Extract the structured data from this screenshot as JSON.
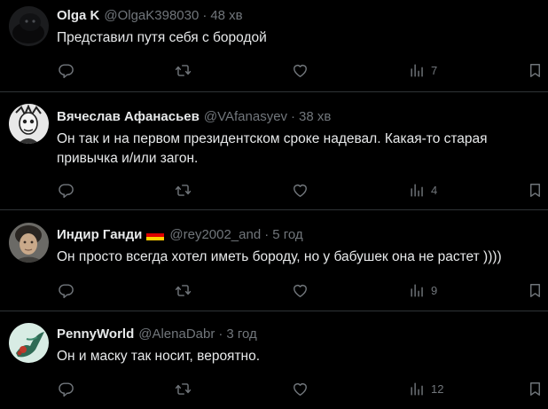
{
  "tweets": [
    {
      "name": "Olga K",
      "handle": "@OlgaK398030",
      "separator": "·",
      "time": "48 хв",
      "text": "Представил путя себя с бородой",
      "views": "7",
      "flag": false
    },
    {
      "name": "Вячеслав Афанасьев",
      "handle": "@VAfanasyev",
      "separator": "·",
      "time": "38 хв",
      "text": "Он так и на первом президентском сроке надевал. Какая-то старая привычка и/или загон.",
      "views": "4",
      "flag": false
    },
    {
      "name": "Индир Ганди",
      "handle": "@rey2002_and",
      "separator": "·",
      "time": "5 год",
      "text": "Он просто всегда хотел иметь бороду, но у бабушек она не растет ))))",
      "views": "9",
      "flag": true
    },
    {
      "name": "PennyWorld",
      "handle": "@AlenaDabr",
      "separator": "·",
      "time": "3 год",
      "text": "Он и маску так носит, вероятно.",
      "views": "12",
      "flag": false
    }
  ],
  "colors": {
    "background": "#000000",
    "text": "#e7e9ea",
    "muted": "#71767b",
    "divider": "#2f3336"
  },
  "icons": [
    "reply-icon",
    "retweet-icon",
    "like-icon",
    "views-icon",
    "bookmark-icon"
  ]
}
